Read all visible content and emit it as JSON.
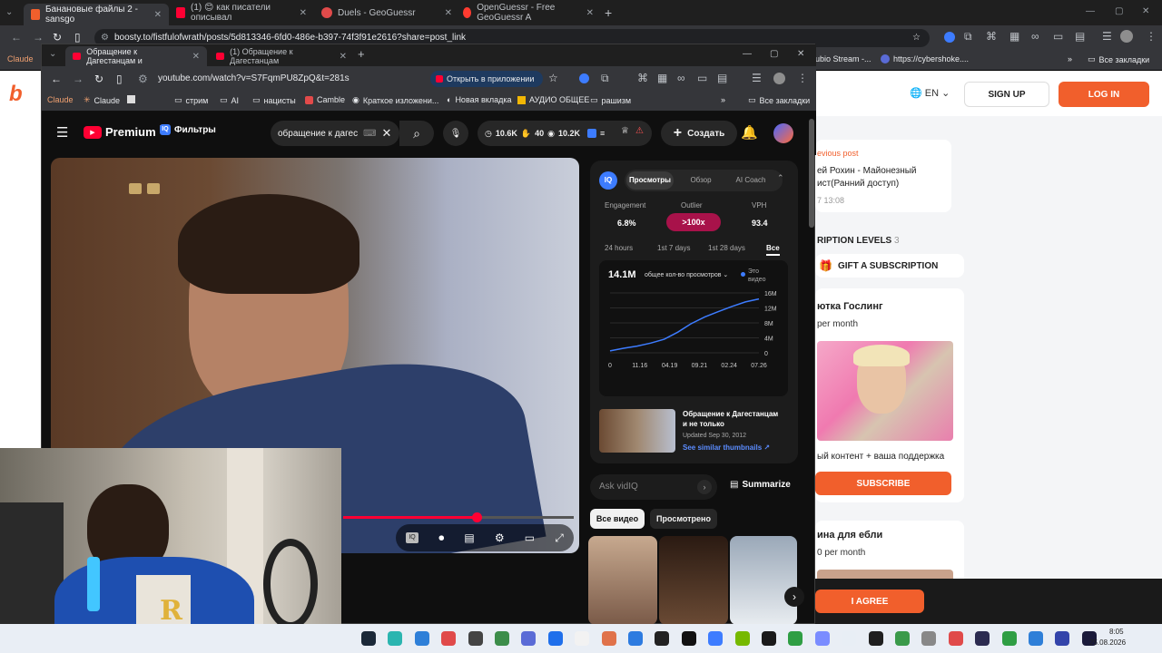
{
  "outer_browser": {
    "tabs": [
      {
        "title": "Банановые файлы 2 - sansgo",
        "active": true
      },
      {
        "title": "(1) 😊 как писатели описывал"
      },
      {
        "title": "Duels - GeoGuessr"
      },
      {
        "title": "OpenGuessr - Free GeoGuessr A"
      }
    ],
    "url": "boosty.to/fistfulofwrath/posts/5d813346-6fd0-486e-b397-74f3f91e2616?share=post_link",
    "bookmarks_left": "Claude",
    "bookmarks_right": [
      {
        "label": "ubio Stream -..."
      },
      {
        "label": "https://cybershoke...."
      },
      {
        "label": "Все закладки"
      }
    ]
  },
  "boosty": {
    "lang": "EN",
    "signup": "SIGN UP",
    "login": "LOG IN",
    "previous_post_label": "evious post",
    "previous_post_title": "ей Рохин - Майонезный\nист(Ранний доступ)",
    "previous_post_time": "7 13:08",
    "levels_label": "RIPTION LEVELS",
    "levels_count": "3",
    "gift": "GIFT A SUBSCRIPTION",
    "tier1_name": "ютка Гослинг",
    "tier1_period": "per month",
    "tier1_desc": "ый контент + ваша поддержка",
    "subscribe": "SUBSCRIBE",
    "tier2_name": "ина для ебли",
    "tier2_period": "0 per month",
    "agree": "I AGREE"
  },
  "inner_browser": {
    "tabs": [
      {
        "title": "Обращение к Дагестанцам и",
        "active": true
      },
      {
        "title": "(1) Обращение к Дагестанцам"
      }
    ],
    "url": "youtube.com/watch?v=S7FqmPU8ZpQ&t=281s",
    "open_app": "Открыть в приложении",
    "bookmarks": [
      "Claude",
      "Claude",
      "стрим",
      "AI",
      "нацисты",
      "Camble",
      "Краткое изложени...",
      "Новая вкладка",
      "АУДИО ОБЩЕЕ",
      "рашизм"
    ],
    "bookmarks_all": "Все закладки"
  },
  "youtube": {
    "logo": "Premium",
    "region": "UA",
    "filters": "Фильтры",
    "search_query": "обращение к дагес",
    "stat1": "10.6K",
    "stat2": "40",
    "stat3": "10.2K",
    "create": "Создать"
  },
  "iq_panel": {
    "tabs": [
      "Просмотры",
      "Обзор",
      "AI Coach"
    ],
    "metrics": [
      {
        "label": "Engagement",
        "value": "6.8%"
      },
      {
        "label": "Outlier",
        "value": ">100x"
      },
      {
        "label": "VPH",
        "value": "93.4"
      }
    ],
    "periods": [
      "24 hours",
      "1st 7 days",
      "1st 28 days",
      "Все"
    ],
    "total_views": "14.1M",
    "views_dropdown": "общее кол-во просмотров",
    "this_video": "Это\nвидео",
    "related_title": "Обращение к Дагестанцам\nи не только",
    "related_updated": "Updated Sep 30, 2012",
    "similar": "See similar thumbnails ↗",
    "ask": "Ask vidIQ",
    "summarize": "Summarize",
    "filter_all": "Все видео",
    "filter_watched": "Просмотрено"
  },
  "chart_data": {
    "type": "line",
    "x_ticks": [
      "0",
      "11.16",
      "04.19",
      "09.21",
      "02.24",
      "07.26"
    ],
    "y_ticks": [
      "16M",
      "12M",
      "8M",
      "4M",
      "0"
    ],
    "ylim": [
      0,
      16
    ],
    "series": [
      {
        "values": [
          0.5,
          1.2,
          1.8,
          2.6,
          3.6,
          5.5,
          7.8,
          9.6,
          11.0,
          12.4,
          13.6,
          14.4
        ]
      }
    ]
  },
  "taskbar": {
    "time": "8:05",
    "date": "25.08.2026",
    "badge": "41"
  },
  "colors": {
    "accent": "#f15f2c",
    "yt_red": "#ff0033",
    "vidiq_blue": "#3d7cff",
    "outlier": "#a8124a"
  }
}
